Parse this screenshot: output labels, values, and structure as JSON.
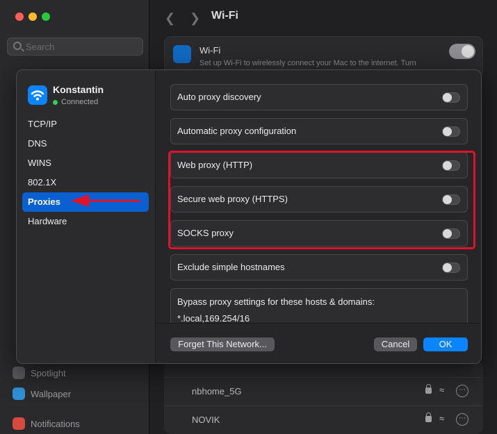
{
  "background": {
    "search_placeholder": "Search",
    "window_title": "Wi-Fi",
    "wifi_card": {
      "title": "Wi-Fi",
      "description": "Set up Wi-Fi to wirelessly connect your Mac to the internet. Turn"
    },
    "sidebar_items": [
      {
        "label": "Spotlight"
      },
      {
        "label": "Wallpaper"
      },
      {
        "label": "Notifications"
      }
    ],
    "networks": [
      {
        "name": "nbhome_5G"
      },
      {
        "name": "NOVIK"
      }
    ]
  },
  "dialog": {
    "network_name": "Konstantin",
    "network_status": "Connected",
    "sidebar": [
      {
        "label": "TCP/IP"
      },
      {
        "label": "DNS"
      },
      {
        "label": "WINS"
      },
      {
        "label": "802.1X"
      },
      {
        "label": "Proxies",
        "selected": true
      },
      {
        "label": "Hardware"
      }
    ],
    "settings": [
      {
        "label": "Auto proxy discovery",
        "enabled": false
      },
      {
        "label": "Automatic proxy configuration",
        "enabled": false
      },
      {
        "label": "Web proxy (HTTP)",
        "enabled": false
      },
      {
        "label": "Secure web proxy (HTTPS)",
        "enabled": false
      },
      {
        "label": "SOCKS proxy",
        "enabled": false
      },
      {
        "label": "Exclude simple hostnames",
        "enabled": false
      }
    ],
    "bypass": {
      "label": "Bypass proxy settings for these hosts & domains:",
      "value": "*.local,169.254/16"
    },
    "buttons": {
      "forget": "Forget This Network...",
      "cancel": "Cancel",
      "ok": "OK"
    }
  },
  "colors": {
    "accent": "#0a84ff",
    "selection": "#0a60d1",
    "highlight_box": "#e0132a",
    "connected": "#30d158"
  }
}
